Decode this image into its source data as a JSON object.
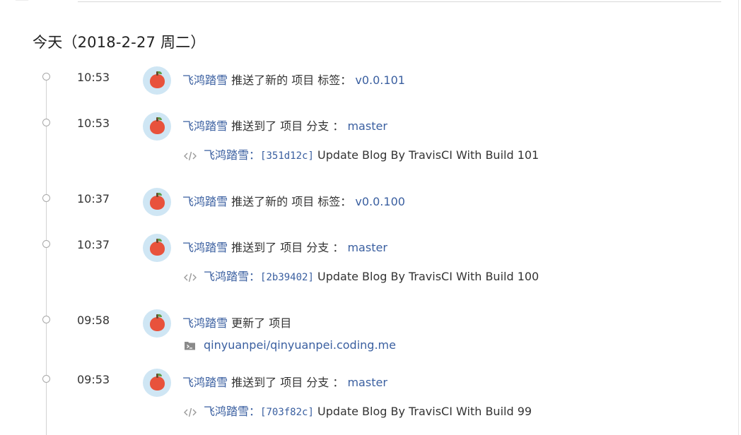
{
  "day_header": "今天（2018-2-27 周二）",
  "events": [
    {
      "time": "10:53",
      "user": "飞鸿踏雪",
      "action": "推送了新的 项目 标签：",
      "target": "v0.0.101"
    },
    {
      "time": "10:53",
      "user": "飞鸿踏雪",
      "action": "推送到了 项目 分支 ：",
      "target": "master",
      "commit": {
        "author": "飞鸿踏雪",
        "colon": "：",
        "hash": "[351d12c]",
        "message": "Update Blog By TravisCI With Build 101"
      }
    },
    {
      "time": "10:37",
      "user": "飞鸿踏雪",
      "action": "推送了新的 项目 标签：",
      "target": "v0.0.100"
    },
    {
      "time": "10:37",
      "user": "飞鸿踏雪",
      "action": "推送到了 项目 分支 ：",
      "target": "master",
      "commit": {
        "author": "飞鸿踏雪",
        "colon": "：",
        "hash": "[2b39402]",
        "message": "Update Blog By TravisCI With Build 100"
      }
    },
    {
      "time": "09:58",
      "user": "飞鸿踏雪",
      "action": "更新了 项目",
      "repo": "qinyuanpei/qinyuanpei.coding.me"
    },
    {
      "time": "09:53",
      "user": "飞鸿踏雪",
      "action": "推送到了 项目 分支 ：",
      "target": "master",
      "commit": {
        "author": "飞鸿踏雪",
        "colon": "：",
        "hash": "[703f82c]",
        "message": "Update Blog By TravisCI With Build 99"
      }
    }
  ],
  "icons": {
    "avatar": "apple-avatar-icon",
    "commit": "code-icon",
    "repo": "terminal-repo-icon"
  },
  "colors": {
    "link": "#3a5fa0",
    "avatar_bg": "#cfe6f4",
    "apple": "#e8523c"
  }
}
